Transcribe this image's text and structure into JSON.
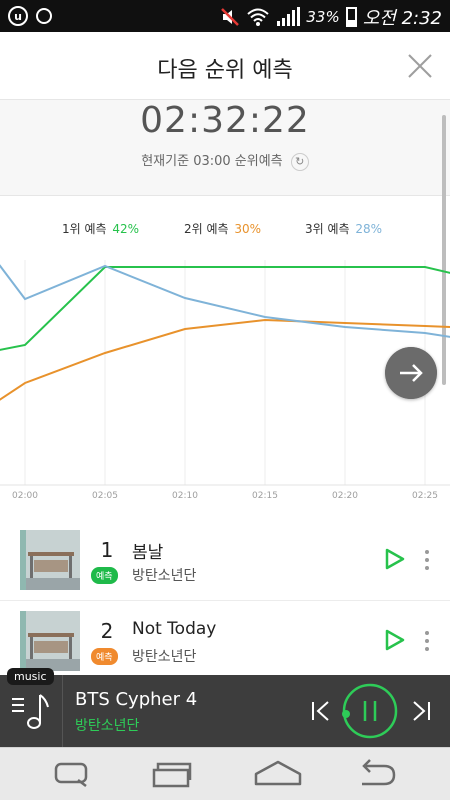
{
  "status_bar": {
    "battery": "33%",
    "time": "오전 2:32",
    "icons": [
      "app-icon-u",
      "app-icon-o",
      "mute-icon",
      "wifi-icon",
      "signal-icon",
      "battery-icon"
    ]
  },
  "header": {
    "title": "다음 순위 예측",
    "close_icon": "close-icon"
  },
  "countdown": {
    "timer": "02:32:22",
    "basis": "현재기준 03:00 순위예측",
    "refresh_icon": "refresh-icon"
  },
  "legend": [
    {
      "label": "1위 예측",
      "pct": "42%",
      "color": "#27c24c"
    },
    {
      "label": "2위 예측",
      "pct": "30%",
      "color": "#e8922c"
    },
    {
      "label": "3위 예측",
      "pct": "28%",
      "color": "#7fb3d8"
    }
  ],
  "chart_data": {
    "type": "line",
    "x": [
      "02:00",
      "02:05",
      "02:10",
      "02:15",
      "02:20",
      "02:25"
    ],
    "series": [
      {
        "color": "#27c24c",
        "points": [
          [
            -1.6,
            350
          ],
          [
            0,
            345
          ],
          [
            5,
            267
          ],
          [
            10,
            267
          ],
          [
            15,
            267
          ],
          [
            20,
            267
          ],
          [
            25,
            267
          ],
          [
            26.6,
            273
          ]
        ]
      },
      {
        "color": "#e8922c",
        "points": [
          [
            -1.6,
            400
          ],
          [
            0,
            383
          ],
          [
            5,
            353
          ],
          [
            10,
            329
          ],
          [
            15,
            320
          ],
          [
            20,
            323
          ],
          [
            25,
            326
          ],
          [
            26.6,
            327
          ]
        ]
      },
      {
        "color": "#7fb3d8",
        "points": [
          [
            -1.6,
            265
          ],
          [
            0,
            299
          ],
          [
            5,
            266
          ],
          [
            10,
            298
          ],
          [
            15,
            317
          ],
          [
            20,
            327
          ],
          [
            25,
            333
          ],
          [
            26.6,
            337
          ]
        ]
      }
    ],
    "grid": true
  },
  "next_fab_icon": "arrow-right-icon",
  "ranking": [
    {
      "rank": "1",
      "title": "봄날",
      "badge": "예측",
      "badge_color": "#1fba4a",
      "artist": "방탄소년단"
    },
    {
      "rank": "2",
      "title": "Not Today",
      "badge": "예측",
      "badge_color": "#f08a2e",
      "artist": "방탄소년단"
    }
  ],
  "player": {
    "tag": "music",
    "title": "BTS Cypher 4",
    "artist": "방탄소년단",
    "accent": "#2ecc58"
  },
  "navbar": {
    "icons": [
      "recent-apps-icon",
      "multiwindow-icon",
      "home-icon",
      "back-icon"
    ]
  }
}
